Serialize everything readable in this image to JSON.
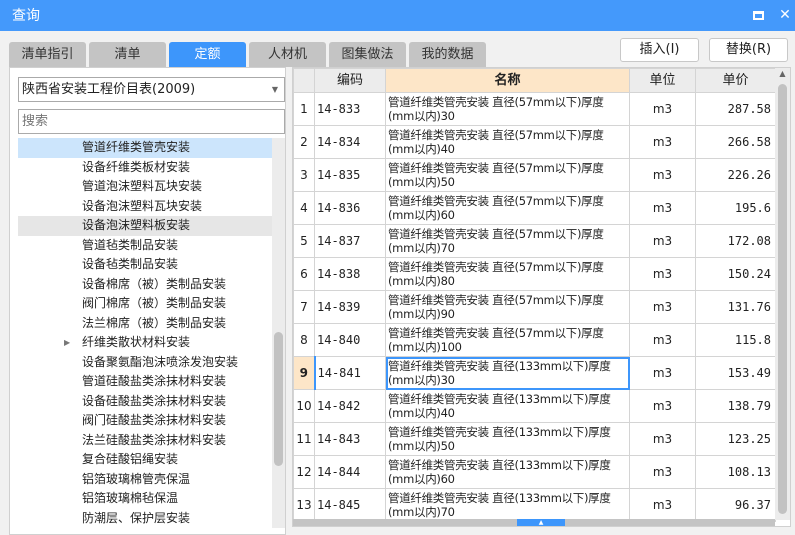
{
  "window": {
    "title": "查询"
  },
  "tabs": [
    {
      "label": "清单指引"
    },
    {
      "label": "清单"
    },
    {
      "label": "定额"
    },
    {
      "label": "人材机"
    },
    {
      "label": "图集做法"
    },
    {
      "label": "我的数据"
    }
  ],
  "actions": {
    "insert": "插入(I)",
    "replace": "替换(R)"
  },
  "left": {
    "library": "陕西省安装工程价目表(2009)",
    "search_placeholder": "搜索",
    "tree": [
      {
        "label": "管道纤维类管壳安装"
      },
      {
        "label": "设备纤维类板材安装"
      },
      {
        "label": "管道泡沫塑料瓦块安装"
      },
      {
        "label": "设备泡沫塑料瓦块安装"
      },
      {
        "label": "设备泡沫塑料板安装"
      },
      {
        "label": "管道毡类制品安装"
      },
      {
        "label": "设备毡类制品安装"
      },
      {
        "label": "设备棉席（被）类制品安装"
      },
      {
        "label": "阀门棉席（被）类制品安装"
      },
      {
        "label": "法兰棉席（被）类制品安装"
      },
      {
        "label": "纤维类散状材料安装"
      },
      {
        "label": "设备聚氨酯泡沫喷涂发泡安装"
      },
      {
        "label": "管道硅酸盐类涂抹材料安装"
      },
      {
        "label": "设备硅酸盐类涂抹材料安装"
      },
      {
        "label": "阀门硅酸盐类涂抹材料安装"
      },
      {
        "label": "法兰硅酸盐类涂抹材料安装"
      },
      {
        "label": "复合硅酸铝绳安装"
      },
      {
        "label": "铝箔玻璃棉管壳保温"
      },
      {
        "label": "铝箔玻璃棉毡保温"
      },
      {
        "label": "防潮层、保护层安装"
      }
    ]
  },
  "grid": {
    "headers": {
      "code": "编码",
      "name": "名称",
      "unit": "单位",
      "price": "单价"
    },
    "rows": [
      {
        "n": "1",
        "code": "14-833",
        "name1": "管道纤维类管壳安装 直径(57mm以下)厚度",
        "name2": "(mm以内)30",
        "unit": "m3",
        "price": "287.58"
      },
      {
        "n": "2",
        "code": "14-834",
        "name1": "管道纤维类管壳安装 直径(57mm以下)厚度",
        "name2": "(mm以内)40",
        "unit": "m3",
        "price": "266.58"
      },
      {
        "n": "3",
        "code": "14-835",
        "name1": "管道纤维类管壳安装 直径(57mm以下)厚度",
        "name2": "(mm以内)50",
        "unit": "m3",
        "price": "226.26"
      },
      {
        "n": "4",
        "code": "14-836",
        "name1": "管道纤维类管壳安装 直径(57mm以下)厚度",
        "name2": "(mm以内)60",
        "unit": "m3",
        "price": "195.6"
      },
      {
        "n": "5",
        "code": "14-837",
        "name1": "管道纤维类管壳安装 直径(57mm以下)厚度",
        "name2": "(mm以内)70",
        "unit": "m3",
        "price": "172.08"
      },
      {
        "n": "6",
        "code": "14-838",
        "name1": "管道纤维类管壳安装 直径(57mm以下)厚度",
        "name2": "(mm以内)80",
        "unit": "m3",
        "price": "150.24"
      },
      {
        "n": "7",
        "code": "14-839",
        "name1": "管道纤维类管壳安装 直径(57mm以下)厚度",
        "name2": "(mm以内)90",
        "unit": "m3",
        "price": "131.76"
      },
      {
        "n": "8",
        "code": "14-840",
        "name1": "管道纤维类管壳安装 直径(57mm以下)厚度",
        "name2": "(mm以内)100",
        "unit": "m3",
        "price": "115.8"
      },
      {
        "n": "9",
        "code": "14-841",
        "name1": "管道纤维类管壳安装 直径(133mm以下)厚度",
        "name2": "(mm以内)30",
        "unit": "m3",
        "price": "153.49"
      },
      {
        "n": "10",
        "code": "14-842",
        "name1": "管道纤维类管壳安装 直径(133mm以下)厚度",
        "name2": "(mm以内)40",
        "unit": "m3",
        "price": "138.79"
      },
      {
        "n": "11",
        "code": "14-843",
        "name1": "管道纤维类管壳安装 直径(133mm以下)厚度",
        "name2": "(mm以内)50",
        "unit": "m3",
        "price": "123.25"
      },
      {
        "n": "12",
        "code": "14-844",
        "name1": "管道纤维类管壳安装 直径(133mm以下)厚度",
        "name2": "(mm以内)60",
        "unit": "m3",
        "price": "108.13"
      },
      {
        "n": "13",
        "code": "14-845",
        "name1": "管道纤维类管壳安装 直径(133mm以下)厚度",
        "name2": "(mm以内)70",
        "unit": "m3",
        "price": "96.37"
      }
    ]
  }
}
